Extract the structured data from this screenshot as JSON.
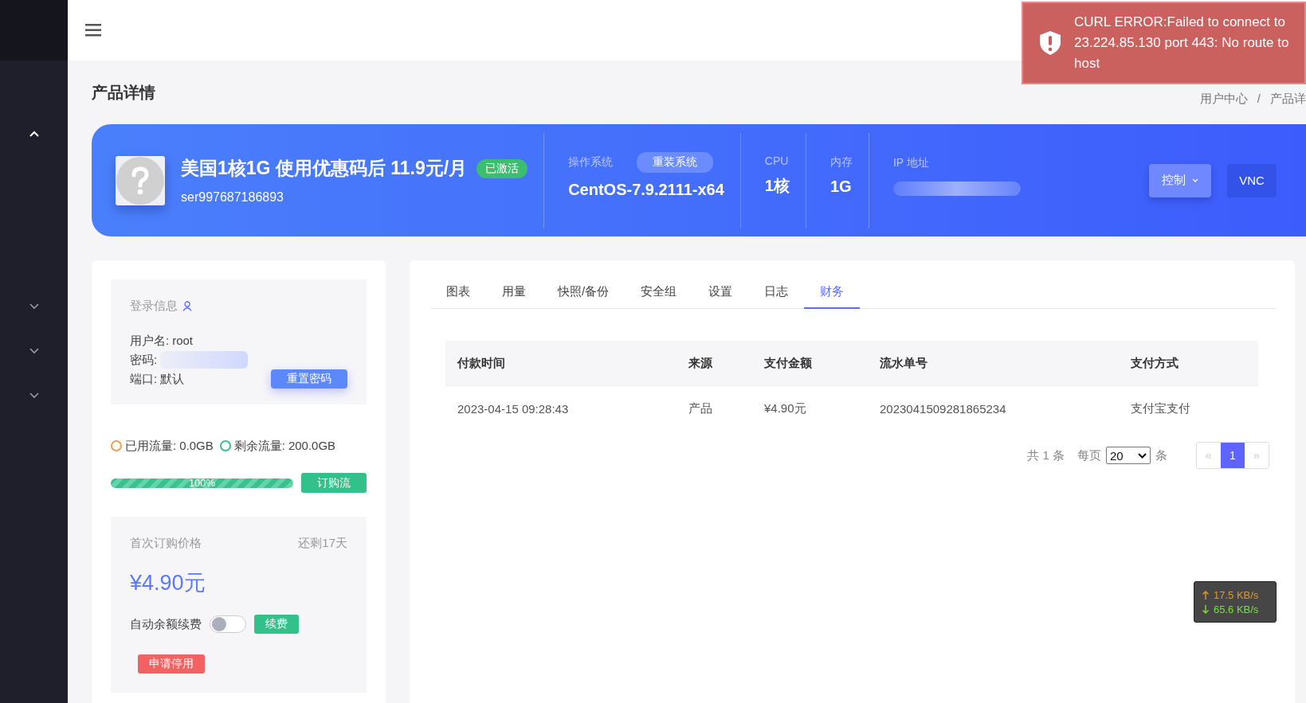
{
  "page_title": "产品详情",
  "breadcrumb": [
    "用户中心",
    "/",
    "产品详"
  ],
  "sidebar": {
    "items": [
      {
        "expanded": true
      },
      {
        "expanded": false
      },
      {
        "expanded": false
      },
      {
        "expanded": false
      }
    ]
  },
  "toast": {
    "kind": "error",
    "message": "CURL ERROR:Failed to connect to 23.224.85.130 port 443: No route to host"
  },
  "product": {
    "name": "美国1核1G 使用优惠码后 11.9元/月",
    "status": "已激活",
    "id": "ser997687186893",
    "os_label": "操作系统",
    "reinstall_button": "重装系统",
    "os": "CentOS-7.9.2111-x64",
    "cpu_label": "CPU",
    "cpu": "1核",
    "mem_label": "内存",
    "mem": "1G",
    "ip_label": "IP 地址",
    "control_button": "控制",
    "vnc_button": "VNC"
  },
  "login": {
    "title": "登录信息",
    "username_label": "用户名:",
    "username": "root",
    "password_label": "密码:",
    "port_label": "端口:",
    "port": "默认",
    "reset_button": "重置密码"
  },
  "traffic": {
    "used_label": "已用流量:",
    "used": "0.0GB",
    "remaining_label": "剩余流量:",
    "remaining": "200.0GB",
    "level": 1.0,
    "reading": "100%",
    "buy_button": "订购流"
  },
  "pricing": {
    "title": "首次订购价格",
    "remaining_days": "还剩17天",
    "price": "¥4.90元",
    "auto_renew_label": "自动余额续费",
    "auto_renew": false,
    "renew_button": "续费",
    "cancel_button": "申请停用"
  },
  "tabs": [
    {
      "label": "图表",
      "selected": false
    },
    {
      "label": "用量",
      "selected": false
    },
    {
      "label": "快照/备份",
      "selected": false
    },
    {
      "label": "安全组",
      "selected": false
    },
    {
      "label": "设置",
      "selected": false
    },
    {
      "label": "日志",
      "selected": false
    },
    {
      "label": "财务",
      "selected": true
    }
  ],
  "table": {
    "columns": [
      "付款时间",
      "来源",
      "支付金额",
      "流水单号",
      "支付方式"
    ],
    "rows": [
      [
        "2023-04-15 09:28:43",
        "产品",
        "¥4.90元",
        "2023041509281865234",
        "支付宝支付"
      ]
    ]
  },
  "pagination": {
    "total": "共 1 条",
    "per_page_label": "每页",
    "per_page": "20",
    "per_page_unit": "条",
    "prev": "«",
    "pages": [
      {
        "label": "1",
        "selected": true
      }
    ],
    "next": "»"
  },
  "speed": {
    "up": "17.5 KB/s",
    "down": "65.6 KB/s"
  }
}
